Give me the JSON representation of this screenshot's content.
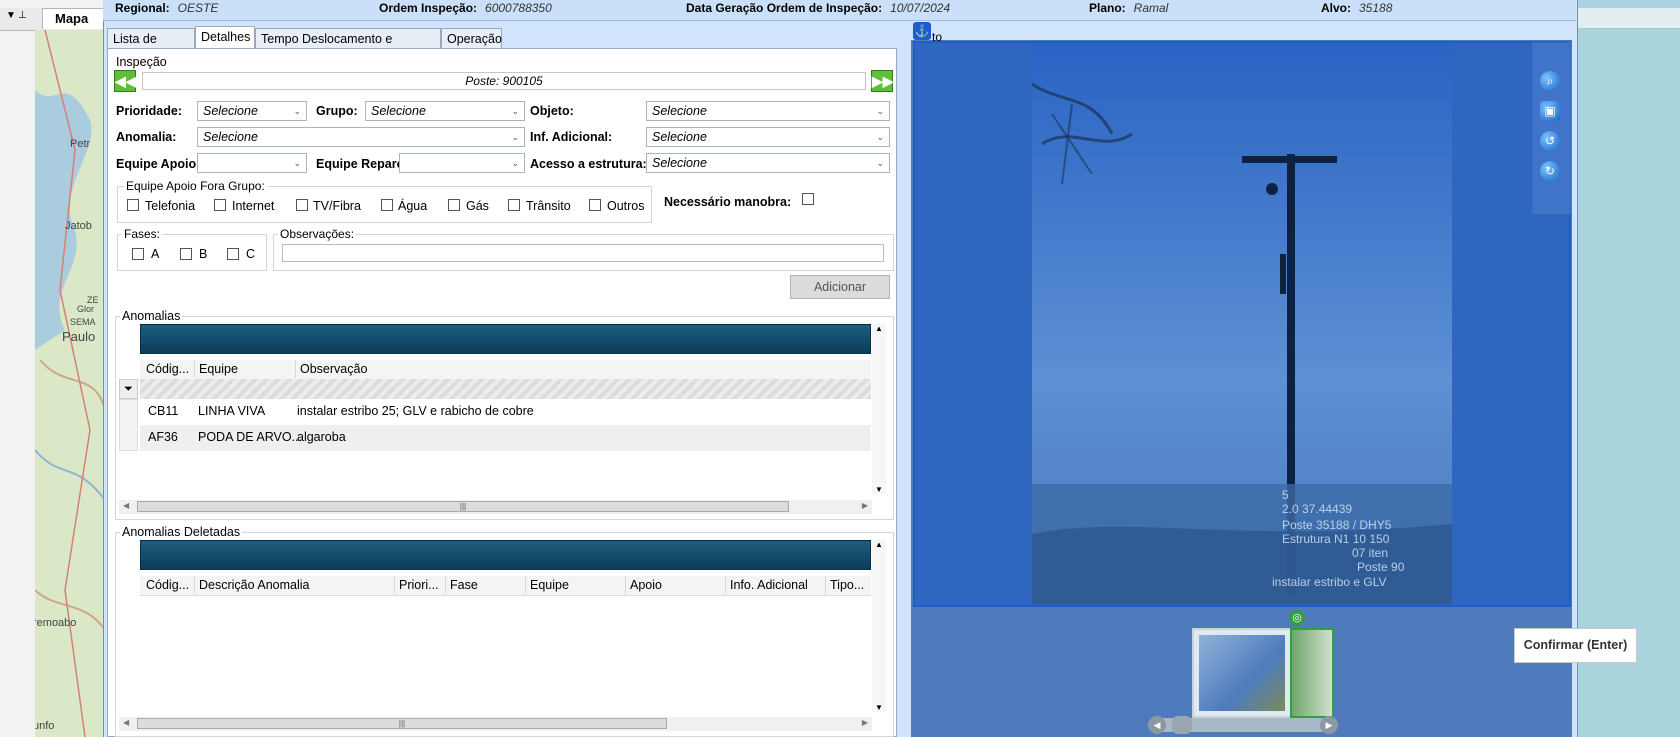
{
  "background": {
    "tab_label": "Mapa",
    "map_labels": [
      "Petr",
      "Jatob",
      "ZE",
      "Glor",
      "SEMA",
      "Paulo",
      "remoabo",
      "unfo"
    ]
  },
  "header": {
    "regional_label": "Regional:",
    "regional_value": "OESTE",
    "ordem_label": "Ordem Inspeção:",
    "ordem_value": "6000788350",
    "data_label": "Data Geração Ordem de Inspeção:",
    "data_value": "10/07/2024",
    "plano_label": "Plano:",
    "plano_value": "Ramal",
    "alvo_label": "Alvo:",
    "alvo_value": "35188"
  },
  "tabs": [
    "Lista de Postes",
    "Detalhes",
    "Tempo Deslocamento e Inspeção",
    "Operação"
  ],
  "inspecao": {
    "group_label": "Inspeção",
    "poste_text": "Poste: 900105"
  },
  "form": {
    "prioridade_label": "Prioridade:",
    "prioridade_value": "Selecione",
    "grupo_label": "Grupo:",
    "grupo_value": "Selecione",
    "objeto_label": "Objeto:",
    "objeto_value": "Selecione",
    "anomalia_label": "Anomalia:",
    "anomalia_value": "Selecione",
    "inf_adicional_label": "Inf. Adicional:",
    "inf_adicional_value": "Selecione",
    "equipe_apoio_label": "Equipe Apoio:",
    "equipe_apoio_value": "",
    "equipe_reparo_label": "Equipe Reparo:",
    "equipe_reparo_value": "",
    "acesso_label": "Acesso a estrutura:",
    "acesso_value": "Selecione"
  },
  "equipe_fora": {
    "group_label": "Equipe Apoio Fora Grupo:",
    "options": [
      "Telefonia",
      "Internet",
      "TV/Fibra",
      "Água",
      "Gás",
      "Trânsito",
      "Outros"
    ],
    "manobra_label": "Necessário manobra:"
  },
  "fases": {
    "group_label": "Fases:",
    "options": [
      "A",
      "B",
      "C"
    ]
  },
  "observacoes": {
    "label": "Observações:",
    "value": ""
  },
  "adicionar_label": "Adicionar",
  "anomalias": {
    "group_label": "Anomalias",
    "columns": [
      "Códig...",
      "Equipe",
      "Observação"
    ],
    "rows": [
      {
        "codigo": "CB11",
        "equipe": "LINHA VIVA",
        "observacao": "instalar estribo 25; GLV e rabicho  de cobre"
      },
      {
        "codigo": "AF36",
        "equipe": "PODA DE ARVO...",
        "observacao": "algaroba"
      }
    ]
  },
  "anomalias_deletadas": {
    "group_label": "Anomalias Deletadas",
    "columns": [
      "Códig...",
      "Descrição Anomalia",
      "Priori...",
      "Fase",
      "Equipe",
      "Apoio",
      "Info. Adicional",
      "Tipo..."
    ]
  },
  "photo": {
    "label": "to",
    "overlay_lines": [
      "5",
      "2.0 37.44439",
      "Poste 35188 / DHY5",
      "Estrutura N1 10 150",
      "07 iten",
      "Poste 90",
      "instalar estribo e GLV"
    ]
  },
  "confirm_label": "Confirmar (Enter)",
  "colors": {
    "accent": "#1d5cc9",
    "grid_header": "#0c3d58",
    "nav_green": "#5fbf3a"
  }
}
